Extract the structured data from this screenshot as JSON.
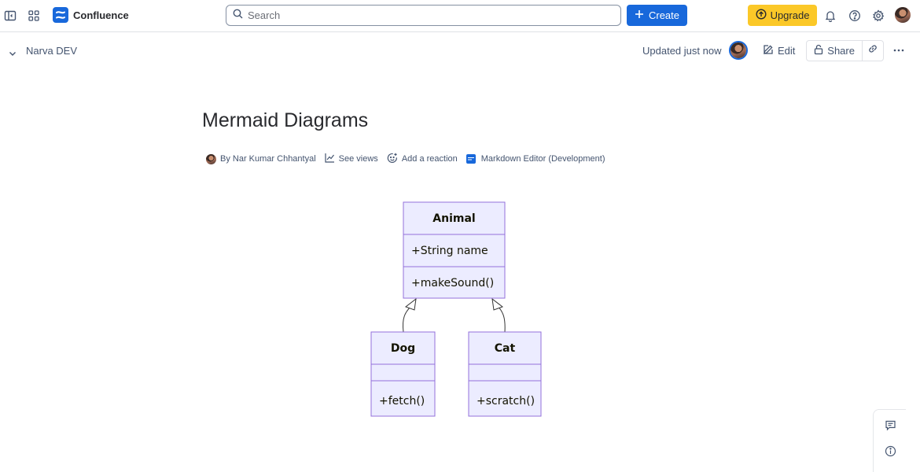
{
  "topnav": {
    "app_name": "Confluence",
    "search_placeholder": "Search",
    "create_label": "Create",
    "upgrade_label": "Upgrade",
    "icons": [
      "sidebar-toggle-icon",
      "app-switcher-icon",
      "confluence-logo-icon",
      "search-icon",
      "plus-icon",
      "upgrade-arrow-icon",
      "bell-icon",
      "help-icon",
      "gear-icon",
      "avatar"
    ]
  },
  "page_header": {
    "space_name": "Narva DEV",
    "updated_text": "Updated just now",
    "edit_label": "Edit",
    "share_label": "Share"
  },
  "content": {
    "title": "Mermaid Diagrams",
    "byline": {
      "author": "By Nar Kumar Chhantyal",
      "see_views": "See views",
      "add_reaction": "Add a reaction",
      "app": "Markdown Editor (Development)"
    }
  },
  "diagram": {
    "type": "class-diagram",
    "classes": [
      {
        "name": "Animal",
        "attributes": [
          "+String name"
        ],
        "methods": [
          "+makeSound()"
        ]
      },
      {
        "name": "Dog",
        "attributes": [],
        "methods": [
          "+fetch()"
        ]
      },
      {
        "name": "Cat",
        "attributes": [],
        "methods": [
          "+scratch()"
        ]
      }
    ],
    "relations": [
      {
        "from": "Dog",
        "to": "Animal",
        "kind": "inheritance"
      },
      {
        "from": "Cat",
        "to": "Animal",
        "kind": "inheritance"
      }
    ],
    "colors": {
      "fill": "#ececff",
      "stroke": "#9370db",
      "text": "#131300"
    }
  },
  "colors": {
    "brand_blue": "#1868db",
    "upgrade_yellow": "#fbc828",
    "text_primary": "#292a2e",
    "text_subtle": "#44546f"
  }
}
